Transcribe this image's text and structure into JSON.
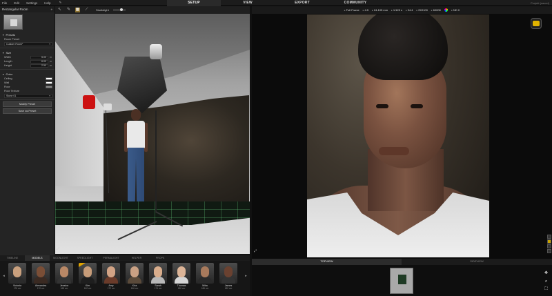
{
  "menu": [
    "File",
    "Edit",
    "Settings",
    "Help"
  ],
  "nav_tabs": [
    {
      "label": "SETUP",
      "active": true
    },
    {
      "label": "VIEW",
      "active": false
    },
    {
      "label": "EXPORT",
      "active": false
    },
    {
      "label": "COMMUNITY",
      "active": false
    }
  ],
  "project_name": "Projekt (saved)",
  "left_panel": {
    "title": "Rectangular Room",
    "presets_section": "Presets",
    "room_preset_label": "Room Preset",
    "room_preset_value": "Custom Room*",
    "size_section": "Size",
    "width_label": "Width",
    "width_value": "5.00",
    "length_label": "Length",
    "length_value": "6.00",
    "height_label": "Height",
    "height_value": "2.50",
    "unit": "m",
    "color_section": "Color",
    "ceiling_label": "Ceiling",
    "wall_label": "Wall",
    "floor_label": "Floor",
    "floor_texture_label": "Floor Texture",
    "floor_texture_value": "Stone 01",
    "modify_btn": "Modify Preset",
    "save_btn": "Save as Preset"
  },
  "scene_toolbar": {
    "studiolight_label": "Studiolight"
  },
  "camera_toolbar": {
    "sensor": "Full Frame",
    "ratio": "4:5",
    "focal": "24-105 mm",
    "shutter": "1/125 s",
    "aperture": "f/4.4",
    "iso": "ISO100",
    "wb": "6000K",
    "nd": "ND 0"
  },
  "bottom_tabs_left": [
    {
      "label": "TIMELINE",
      "active": false
    },
    {
      "label": "MODELS",
      "active": true
    },
    {
      "label": "MOONLIGHT",
      "active": false
    },
    {
      "label": "SPEEDLIGHT",
      "active": false
    },
    {
      "label": "PERMALIGHT",
      "active": false
    },
    {
      "label": "HELPER",
      "active": false
    },
    {
      "label": "PROPS",
      "active": false
    }
  ],
  "models": [
    {
      "name": "Victoria",
      "height": "176 cm",
      "skin": "#c9a07e",
      "shirt": "#2b2b2b",
      "badge": false
    },
    {
      "name": "Alexandra",
      "height": "170 cm",
      "skin": "#7a4e36",
      "shirt": "#3a2a22",
      "badge": false
    },
    {
      "name": "Jessica",
      "height": "168 cm",
      "skin": "#b98866",
      "shirt": "#333333",
      "badge": false
    },
    {
      "name": "Kim",
      "height": "162 cm",
      "skin": "#c79c79",
      "shirt": "#1e1e1e",
      "badge": true
    },
    {
      "name": "Amy",
      "height": "172 cm",
      "skin": "#d2a385",
      "shirt": "#6a3b2a",
      "badge": false
    },
    {
      "name": "Kira",
      "height": "166 cm",
      "skin": "#caa184",
      "shirt": "#5a4a3a",
      "badge": false
    },
    {
      "name": "Sarah",
      "height": "174 cm",
      "skin": "#d9ad8c",
      "shirt": "#b8b8b8",
      "badge": false
    },
    {
      "name": "Thomas",
      "height": "180 cm",
      "skin": "#dcb497",
      "shirt": "#d6d6d6",
      "badge": false
    },
    {
      "name": "Mika",
      "height": "186 cm",
      "skin": "#a87a5c",
      "shirt": "#2a2a2a",
      "badge": false
    },
    {
      "name": "James",
      "height": "182 cm",
      "skin": "#6a4130",
      "shirt": "#333333",
      "badge": false
    }
  ],
  "bottom_tabs_right": [
    {
      "label": "TOPVIEW",
      "active": true
    },
    {
      "label": "SIDEVIEW",
      "active": false
    }
  ]
}
